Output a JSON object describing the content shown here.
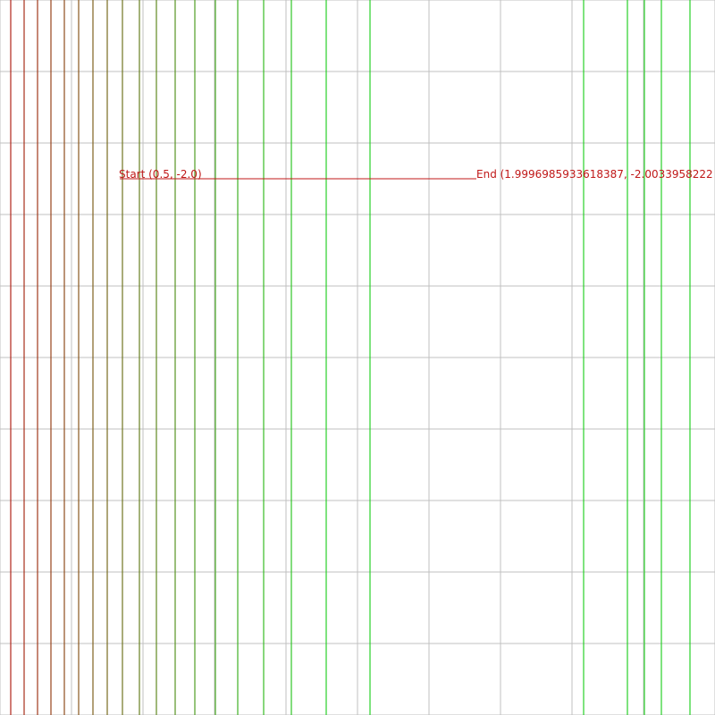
{
  "start_label": "Start (0.5, -2.0)",
  "end_label": "End (1.9996985933618387, -2.0033958222",
  "path": {
    "start": [
      0.5,
      -2.0
    ],
    "end": [
      1.9996985933618387,
      -2.0033958222
    ],
    "color": "#c01818"
  },
  "colors": {
    "grid": "#c0c0c0",
    "contour_warm": "#a0281e",
    "contour_cool": "#2ed82e"
  },
  "field_lines": {
    "count": 25,
    "color_start": "#b0261a",
    "color_end": "#28d028"
  }
}
